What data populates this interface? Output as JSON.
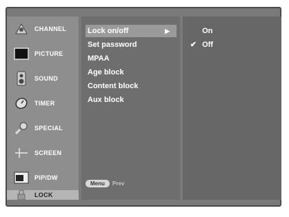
{
  "sidebar": {
    "items": [
      {
        "label": "CHANNEL",
        "icon": "channel-icon"
      },
      {
        "label": "PICTURE",
        "icon": "picture-icon"
      },
      {
        "label": "SOUND",
        "icon": "sound-icon"
      },
      {
        "label": "TIMER",
        "icon": "timer-icon"
      },
      {
        "label": "SPECIAL",
        "icon": "special-icon"
      },
      {
        "label": "SCREEN",
        "icon": "screen-icon"
      },
      {
        "label": "PIP/DW",
        "icon": "pip-icon"
      },
      {
        "label": "LOCK",
        "icon": "lock-icon",
        "active": true
      }
    ]
  },
  "submenu": {
    "items": [
      {
        "label": "Lock on/off",
        "selected": true
      },
      {
        "label": "Set password"
      },
      {
        "label": "MPAA"
      },
      {
        "label": "Age block"
      },
      {
        "label": "Content block"
      },
      {
        "label": "Aux block"
      }
    ],
    "arrow": "▶"
  },
  "options": {
    "items": [
      {
        "label": "On",
        "checked": false
      },
      {
        "label": "Off",
        "checked": true
      }
    ],
    "check": "✔"
  },
  "hint": {
    "menu_label": "Menu",
    "prev_label": "Prev"
  }
}
